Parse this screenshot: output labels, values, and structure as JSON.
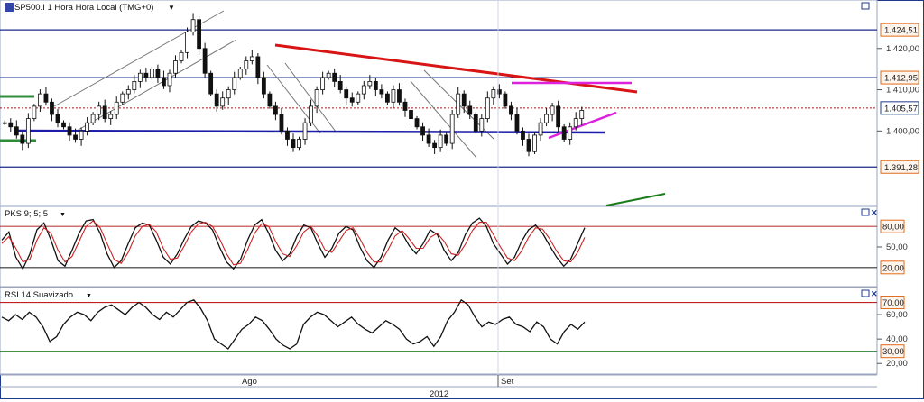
{
  "chart_data": [
    {
      "type": "candlestick",
      "title": "SP500.I 1 Hora Hora Local (TMG+0)",
      "ylim": [
        1385,
        1430
      ],
      "y_ticks": [
        1420.0,
        1410.0,
        1400.0
      ],
      "y_tick_labels": [
        "1.420,00",
        "1.410,00",
        "1.400,00"
      ],
      "price_levels": [
        {
          "label": "1.424,51",
          "value": 1424.51,
          "color": "#1c2a8c"
        },
        {
          "label": "1.412,95",
          "value": 1412.95,
          "color": "#1c2a8c"
        },
        {
          "label": "1.405,57",
          "value": 1405.57,
          "color": "#7a0000"
        },
        {
          "label": "1.391,28",
          "value": 1391.28,
          "color": "#1c2a8c"
        }
      ],
      "close_approx": [
        1402,
        1401,
        1399,
        1397,
        1403,
        1406,
        1409,
        1407,
        1404,
        1402,
        1401,
        1399,
        1398,
        1400,
        1402,
        1404,
        1406,
        1403,
        1404,
        1407,
        1409,
        1410,
        1412,
        1414,
        1413,
        1415,
        1413,
        1411,
        1414,
        1417,
        1419,
        1424,
        1427,
        1420,
        1414,
        1409,
        1406,
        1408,
        1410,
        1413,
        1415,
        1417,
        1418,
        1413,
        1409,
        1406,
        1404,
        1400,
        1398,
        1396,
        1398,
        1402,
        1406,
        1410,
        1413,
        1414,
        1412,
        1410,
        1408,
        1407,
        1409,
        1411,
        1412,
        1410,
        1409,
        1407,
        1410,
        1407,
        1405,
        1403,
        1401,
        1399,
        1397,
        1396,
        1399,
        1397,
        1404,
        1409,
        1406,
        1404,
        1400,
        1403,
        1408,
        1410,
        1409,
        1406,
        1404,
        1400,
        1398,
        1395,
        1399,
        1402,
        1404,
        1406,
        1401,
        1398,
        1401,
        1403,
        1405
      ]
    },
    {
      "type": "line",
      "title": "PKS 9; 5; 5",
      "ylim": [
        0,
        100
      ],
      "y_ticks": [
        50
      ],
      "y_tick_labels": [
        "50,00"
      ],
      "levels": [
        {
          "label": "80,00",
          "value": 80
        },
        {
          "label": "20,00",
          "value": 20
        }
      ],
      "series": [
        {
          "color": "#111111",
          "values": [
            60,
            72,
            35,
            18,
            40,
            75,
            85,
            60,
            30,
            22,
            45,
            70,
            88,
            90,
            70,
            40,
            20,
            30,
            55,
            78,
            85,
            82,
            60,
            35,
            25,
            40,
            62,
            80,
            88,
            85,
            75,
            50,
            28,
            18,
            32,
            60,
            82,
            90,
            70,
            45,
            30,
            40,
            65,
            82,
            78,
            55,
            35,
            48,
            70,
            80,
            75,
            50,
            30,
            20,
            35,
            60,
            78,
            70,
            52,
            40,
            55,
            75,
            68,
            45,
            30,
            42,
            68,
            85,
            92,
            80,
            55,
            40,
            25,
            35,
            58,
            75,
            82,
            70,
            52,
            35,
            22,
            32,
            55,
            78
          ]
        },
        {
          "color": "#cc2222",
          "values": [
            55,
            65,
            48,
            28,
            32,
            60,
            78,
            70,
            45,
            28,
            36,
            58,
            80,
            88,
            78,
            55,
            32,
            26,
            42,
            66,
            80,
            83,
            72,
            48,
            32,
            34,
            52,
            72,
            84,
            86,
            80,
            62,
            40,
            24,
            26,
            46,
            70,
            84,
            80,
            58,
            40,
            36,
            52,
            72,
            80,
            66,
            46,
            42,
            58,
            74,
            78,
            62,
            42,
            28,
            28,
            46,
            66,
            74,
            62,
            48,
            48,
            64,
            70,
            58,
            40,
            38,
            54,
            74,
            86,
            86,
            68,
            50,
            34,
            30,
            44,
            64,
            78,
            76,
            62,
            44,
            30,
            28,
            42,
            64
          ]
        }
      ]
    },
    {
      "type": "line",
      "title": "RSI 14 Suavizado",
      "ylim": [
        15,
        80
      ],
      "y_ticks": [
        60,
        40,
        20
      ],
      "y_tick_labels": [
        "60,00",
        "40,00",
        "20,00"
      ],
      "levels": [
        {
          "label": "70,00",
          "value": 70
        },
        {
          "label": "30,00",
          "value": 30
        }
      ],
      "series": [
        {
          "color": "#111111",
          "values": [
            58,
            55,
            60,
            56,
            62,
            58,
            50,
            38,
            42,
            52,
            58,
            62,
            60,
            55,
            62,
            66,
            68,
            64,
            60,
            66,
            70,
            66,
            60,
            56,
            62,
            58,
            64,
            70,
            72,
            65,
            55,
            40,
            36,
            32,
            40,
            48,
            52,
            58,
            55,
            48,
            40,
            35,
            32,
            36,
            52,
            58,
            62,
            60,
            55,
            50,
            54,
            58,
            52,
            48,
            45,
            50,
            55,
            52,
            48,
            40,
            36,
            38,
            42,
            34,
            42,
            55,
            62,
            72,
            68,
            58,
            50,
            54,
            52,
            56,
            58,
            52,
            50,
            46,
            54,
            50,
            40,
            36,
            46,
            52,
            48,
            54
          ]
        }
      ]
    }
  ],
  "x_axis": {
    "labels": [
      "Ago",
      "Set"
    ],
    "year": "2012"
  }
}
